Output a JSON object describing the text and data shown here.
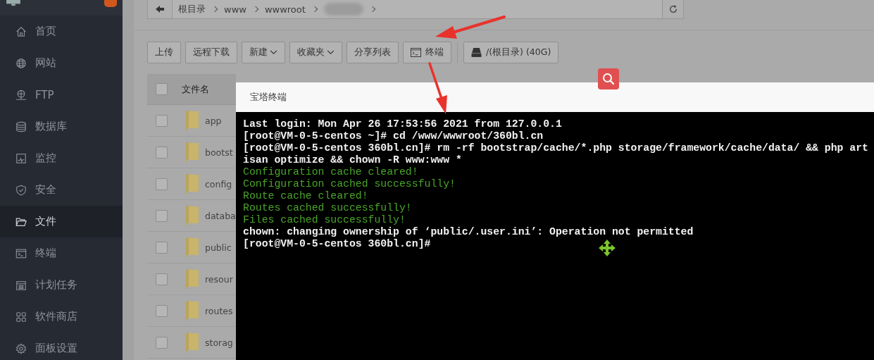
{
  "sidebar": {
    "items": [
      {
        "label": "首页",
        "kind": "home",
        "selected": false
      },
      {
        "label": "网站",
        "kind": "globe",
        "selected": false
      },
      {
        "label": "FTP",
        "kind": "ftp",
        "selected": false
      },
      {
        "label": "数据库",
        "kind": "database",
        "selected": false
      },
      {
        "label": "监控",
        "kind": "monitor",
        "selected": false
      },
      {
        "label": "安全",
        "kind": "shield",
        "selected": false
      },
      {
        "label": "文件",
        "kind": "folder",
        "selected": true
      },
      {
        "label": "终端",
        "kind": "terminal",
        "selected": false
      },
      {
        "label": "计划任务",
        "kind": "calendar",
        "selected": false
      },
      {
        "label": "软件商店",
        "kind": "grid",
        "selected": false
      },
      {
        "label": "面板设置",
        "kind": "gear",
        "selected": false
      }
    ]
  },
  "breadcrumb": {
    "segments": [
      "根目录",
      "www",
      "wwwroot"
    ]
  },
  "toolbar": {
    "buttons": [
      {
        "label": "上传",
        "kind": "plain"
      },
      {
        "label": "远程下载",
        "kind": "plain"
      },
      {
        "label": "新建",
        "kind": "dropdown"
      },
      {
        "label": "收藏夹",
        "kind": "dropdown"
      },
      {
        "label": "分享列表",
        "kind": "plain"
      },
      {
        "label": "终端",
        "kind": "terminal"
      },
      {
        "label": "/(根目录) (40G)",
        "kind": "disk"
      }
    ]
  },
  "table": {
    "columns": [
      "文件名"
    ],
    "all_checked": false,
    "rows": [
      {
        "name": "app",
        "checked": false
      },
      {
        "name": "bootst",
        "checked": false
      },
      {
        "name": "config",
        "checked": false
      },
      {
        "name": "databa",
        "checked": false
      },
      {
        "name": "public",
        "checked": false
      },
      {
        "name": "resour",
        "checked": false
      },
      {
        "name": "routes",
        "checked": false
      },
      {
        "name": "storag",
        "checked": false
      }
    ]
  },
  "terminal": {
    "title": "宝塔终端",
    "lines": [
      {
        "text": "Last login: Mon Apr 26 17:53:56 2021 from 127.0.0.1",
        "kind": "normal"
      },
      {
        "text": "[root@VM-0-5-centos ~]# cd /www/wwwroot/360bl.cn",
        "kind": "normal"
      },
      {
        "text": "[root@VM-0-5-centos 360bl.cn]# rm -rf bootstrap/cache/*.php storage/framework/cache/data/ && php art",
        "kind": "normal"
      },
      {
        "text": "isan optimize && chown -R www:www *",
        "kind": "normal"
      },
      {
        "text": "Configuration cache cleared!",
        "kind": "success"
      },
      {
        "text": "Configuration cached successfully!",
        "kind": "success"
      },
      {
        "text": "Route cache cleared!",
        "kind": "success"
      },
      {
        "text": "Routes cached successfully!",
        "kind": "success"
      },
      {
        "text": "Files cached successfully!",
        "kind": "success"
      },
      {
        "text": "chown: changing ownership of ‘public/.user.ini’: Operation not permitted",
        "kind": "normal"
      },
      {
        "text": "[root@VM-0-5-centos 360bl.cn]#",
        "kind": "normal"
      }
    ]
  }
}
